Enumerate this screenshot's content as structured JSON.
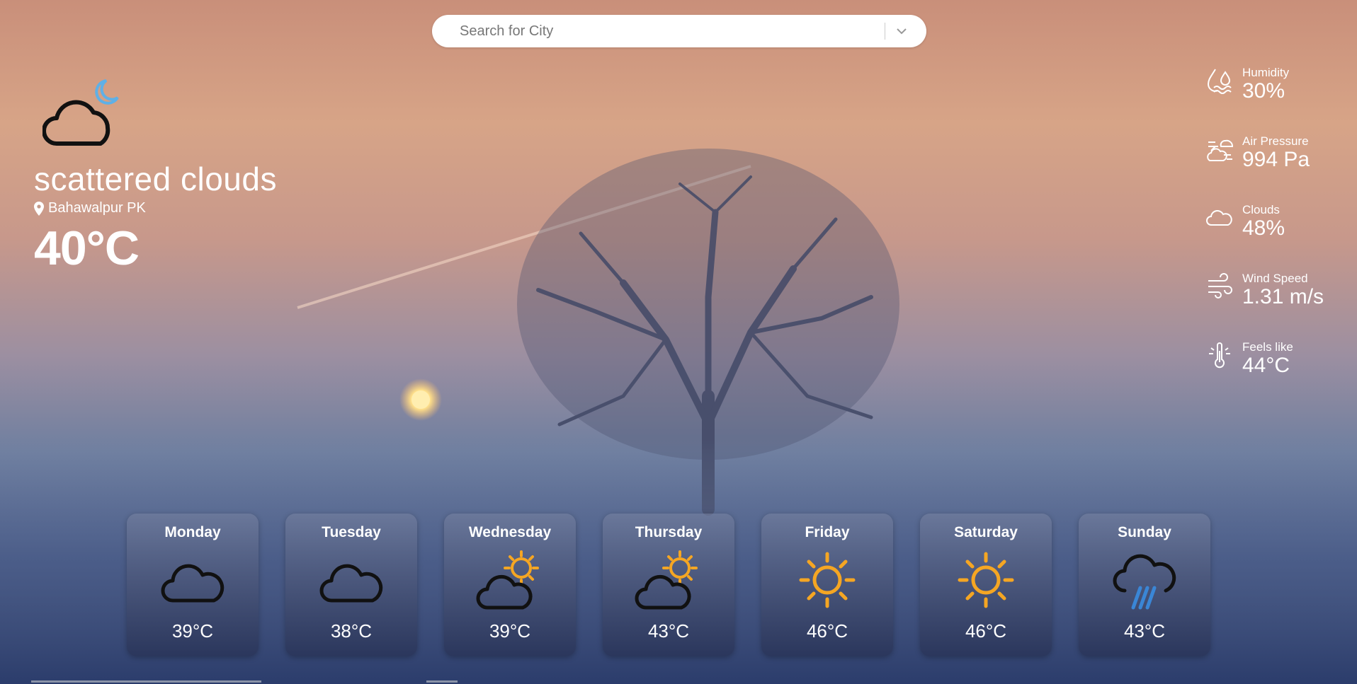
{
  "search": {
    "placeholder": "Search for City"
  },
  "current": {
    "icon": "cloud-moon-icon",
    "description": "scattered clouds",
    "location": "Bahawalpur PK",
    "temperature": "40°C"
  },
  "stats": [
    {
      "icon": "humidity-icon",
      "label": "Humidity",
      "value": "30%"
    },
    {
      "icon": "air-pressure-icon",
      "label": "Air Pressure",
      "value": "994 Pa"
    },
    {
      "icon": "cloud-icon",
      "label": "Clouds",
      "value": "48%"
    },
    {
      "icon": "wind-icon",
      "label": "Wind Speed",
      "value": "1.31 m/s"
    },
    {
      "icon": "thermometer-icon",
      "label": "Feels like",
      "value": "44°C"
    }
  ],
  "forecast": [
    {
      "day": "Monday",
      "icon": "cloud-icon",
      "temp": "39°C"
    },
    {
      "day": "Tuesday",
      "icon": "cloud-icon",
      "temp": "38°C"
    },
    {
      "day": "Wednesday",
      "icon": "sun-cloud-icon",
      "temp": "39°C"
    },
    {
      "day": "Thursday",
      "icon": "sun-cloud-icon",
      "temp": "43°C"
    },
    {
      "day": "Friday",
      "icon": "sun-icon",
      "temp": "46°C"
    },
    {
      "day": "Saturday",
      "icon": "sun-icon",
      "temp": "46°C"
    },
    {
      "day": "Sunday",
      "icon": "rain-cloud-icon",
      "temp": "43°C"
    }
  ],
  "colors": {
    "sun": "#f5a623",
    "rain": "#3a86d6",
    "moon": "#5fb0e6"
  }
}
